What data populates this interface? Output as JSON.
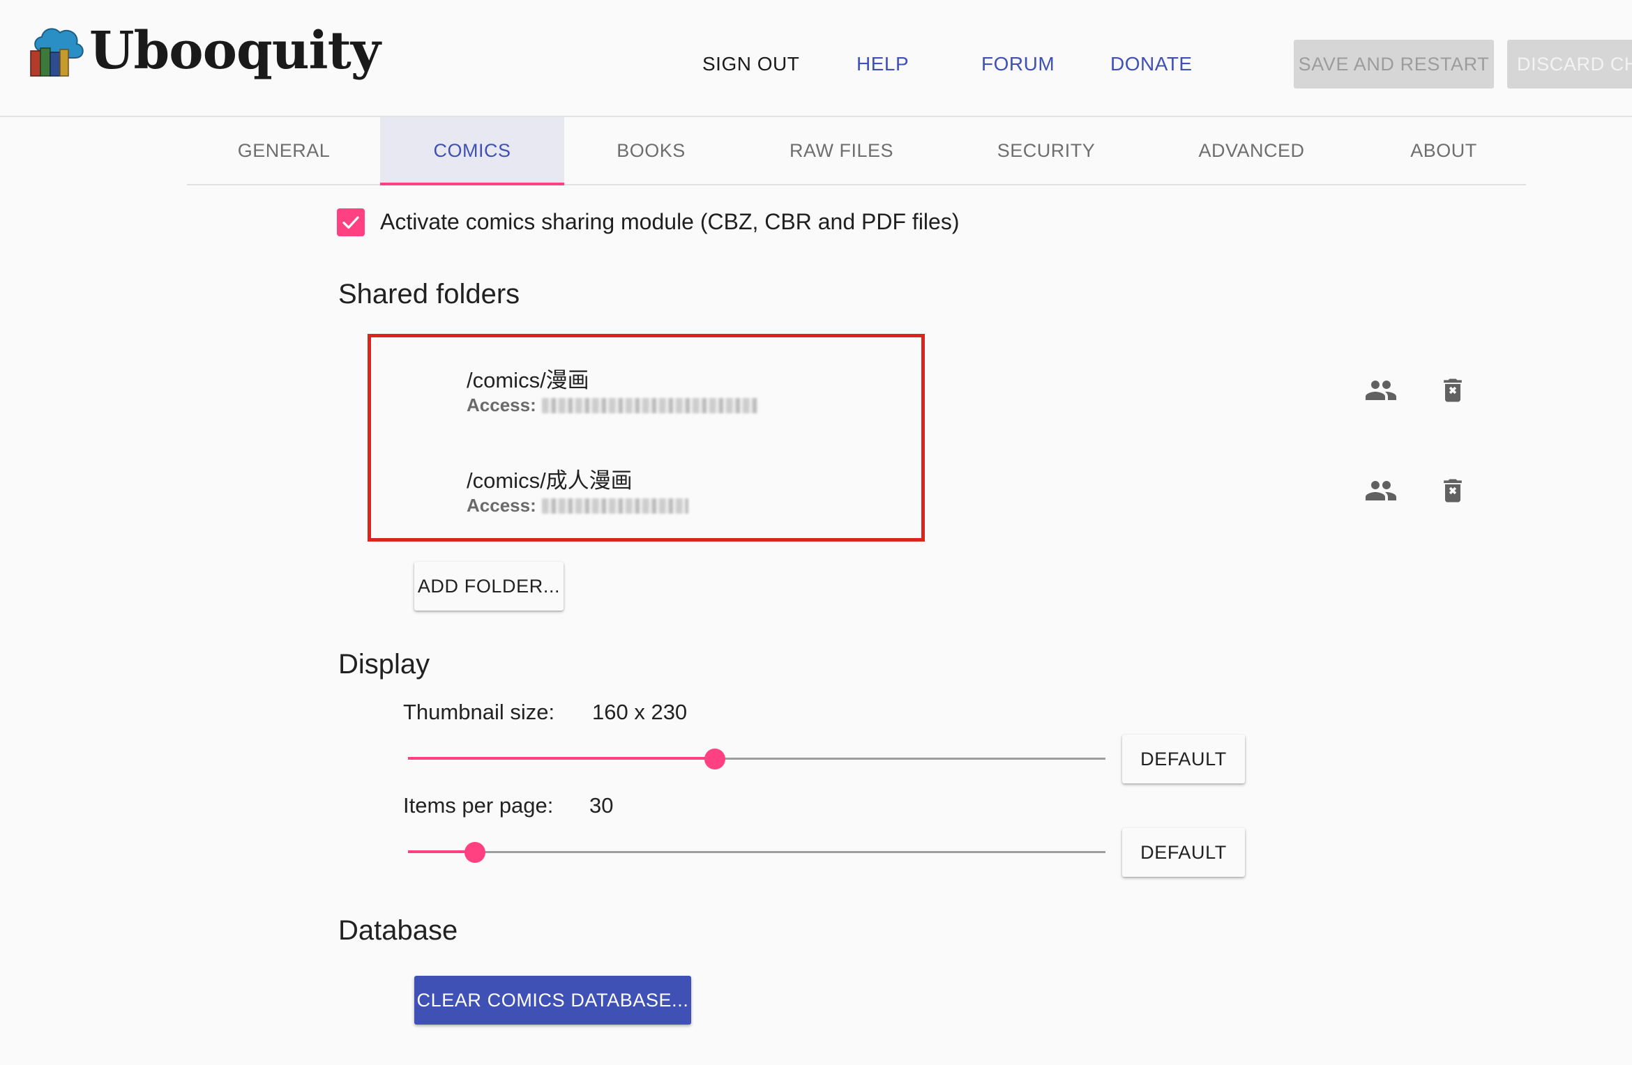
{
  "header": {
    "logo_text": "Ubooquity",
    "nav": {
      "sign_out": "SIGN OUT",
      "help": "HELP",
      "forum": "FORUM",
      "donate": "DONATE"
    },
    "save_restart": "SAVE AND RESTART",
    "discard_changes": "DISCARD CHANGES"
  },
  "tabs": [
    {
      "label": "GENERAL",
      "active": false
    },
    {
      "label": "COMICS",
      "active": true
    },
    {
      "label": "BOOKS",
      "active": false
    },
    {
      "label": "RAW FILES",
      "active": false
    },
    {
      "label": "SECURITY",
      "active": false
    },
    {
      "label": "ADVANCED",
      "active": false
    },
    {
      "label": "ABOUT",
      "active": false
    }
  ],
  "comics": {
    "activate_checked": true,
    "activate_label": "Activate comics sharing module (CBZ, CBR and PDF files)",
    "shared_folders_title": "Shared folders",
    "folders": [
      {
        "path": "/comics/漫画",
        "access_label": "Access:"
      },
      {
        "path": "/comics/成人漫画",
        "access_label": "Access:"
      }
    ],
    "add_folder": "ADD FOLDER...",
    "display_title": "Display",
    "thumbnail_label": "Thumbnail size:",
    "thumbnail_value": "160 x 230",
    "thumbnail_slider_fraction": 0.44,
    "items_label": "Items per page:",
    "items_value": "30",
    "items_slider_fraction": 0.096,
    "default_label": "DEFAULT",
    "database_title": "Database",
    "clear_db": "CLEAR COMICS DATABASE..."
  },
  "colors": {
    "accent": "#ff4081",
    "primary": "#3f51b5",
    "highlight_border": "#d9251d"
  },
  "icons": {
    "logo": "cloud-books-logo",
    "permissions": "people-icon",
    "delete": "delete-icon",
    "check": "check-icon"
  }
}
